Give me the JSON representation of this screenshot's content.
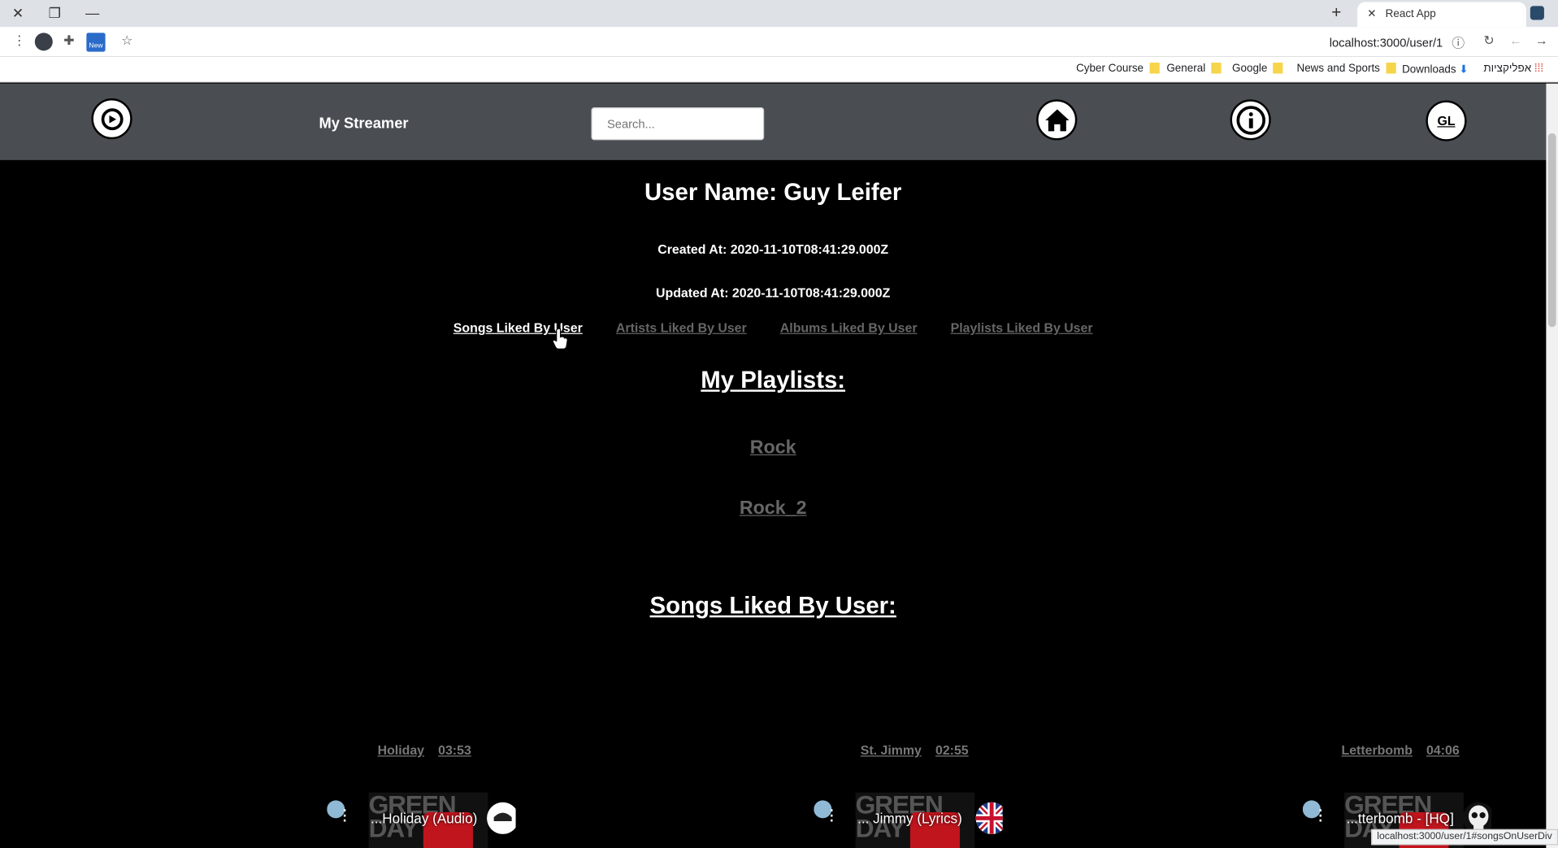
{
  "browser": {
    "tab_title": "React App",
    "url": "localhost:3000/user/1",
    "new_badge": "New",
    "bookmarks": [
      "Cyber Course",
      "General",
      "Google",
      "News and Sports",
      "Downloads",
      "אפליקציות"
    ],
    "status_url": "localhost:3000/user/1#songsOnUserDiv"
  },
  "header": {
    "brand": "My Streamer",
    "search_placeholder": "Search...",
    "user_initials": "GL"
  },
  "user": {
    "name": "User Name: Guy Leifer",
    "created": "Created At: 2020-11-10T08:41:29.000Z",
    "updated": "Updated At: 2020-11-10T08:41:29.000Z"
  },
  "tabs": [
    {
      "label": "Songs Liked By User"
    },
    {
      "label": "Artists Liked By User"
    },
    {
      "label": "Albums Liked By User"
    },
    {
      "label": "Playlists Liked By User"
    }
  ],
  "playlists": {
    "title": "My Playlists:",
    "items": [
      "Rock",
      "Rock_2"
    ]
  },
  "songs": {
    "title": "Songs Liked By User:",
    "items": [
      {
        "name": "Holiday",
        "duration": "03:53",
        "video_title": "...Holiday (Audio)"
      },
      {
        "name": "St. Jimmy",
        "duration": "02:55",
        "video_title": "... Jimmy (Lyrics)"
      },
      {
        "name": "Letterbomb",
        "duration": "04:06",
        "video_title": "...tterbomb - [HQ]"
      }
    ]
  },
  "colors": {
    "header_bg": "#4a4e53",
    "page_bg": "#000000",
    "inactive_link": "#666666"
  }
}
